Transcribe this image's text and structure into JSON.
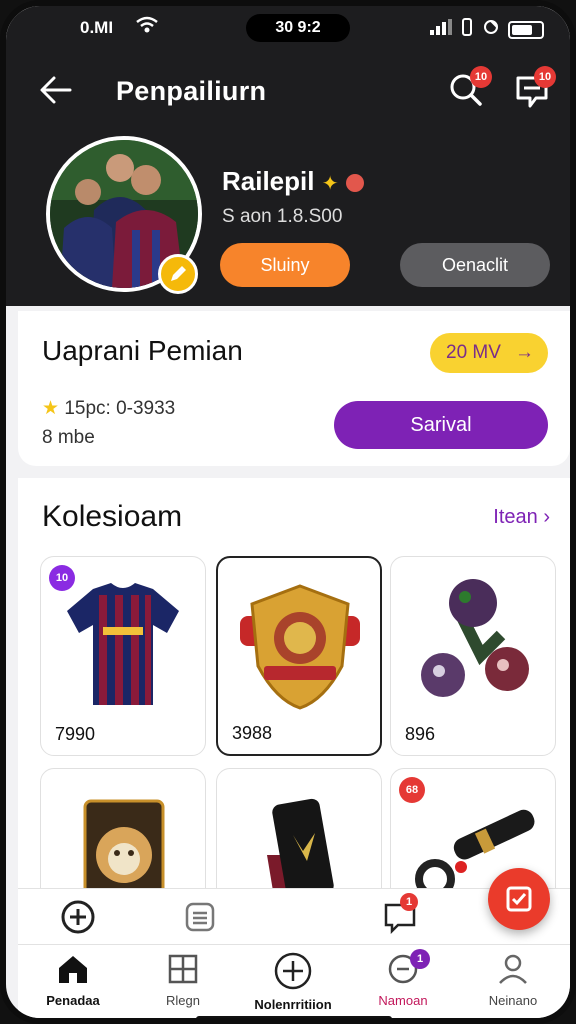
{
  "status": {
    "time": "0.MI",
    "center": "30 9:2",
    "battery_level": 0.7
  },
  "header": {
    "title": "Penpailiurn",
    "search_badge": "10",
    "inbox_badge": "10"
  },
  "profile": {
    "name": "Railepil",
    "subtitle": "S aon 1.8.S00",
    "primary_button": "Sluiny",
    "secondary_button": "Oenaclit"
  },
  "summary": {
    "title": "Uaprani Pemian",
    "pill_label": "20 MV",
    "stat_line": "15pc: 0-3933",
    "stat_line2": "8 mbe",
    "action_button": "Sarival"
  },
  "collection": {
    "title": "Kolesioam",
    "link_label": "Itean",
    "items": [
      {
        "price": "7990",
        "badge": "10",
        "icon": "jersey-icon"
      },
      {
        "price": "3988",
        "badge": "",
        "icon": "shield-crest-icon"
      },
      {
        "price": "896",
        "badge": "",
        "icon": "balls-stand-icon"
      },
      {
        "price": "",
        "badge": "",
        "icon": "lion-card-icon"
      },
      {
        "price": "",
        "badge": "",
        "icon": "phone-stand-icon"
      },
      {
        "price": "",
        "badge": "68",
        "icon": "keychain-icon"
      }
    ]
  },
  "subbar": {
    "badge": "1"
  },
  "nav": {
    "items": [
      {
        "label": "Penadaa",
        "icon": "home-icon"
      },
      {
        "label": "Rlegn",
        "icon": "grid-icon"
      },
      {
        "label": "Nolenrritiion",
        "icon": "plus-circle-icon"
      },
      {
        "label": "Namoan",
        "icon": "chat-icon",
        "badge": "1"
      },
      {
        "label": "Neinano",
        "icon": "user-icon"
      }
    ]
  },
  "colors": {
    "accent": "#7e22b5",
    "orange": "#f7842b",
    "yellow": "#f9d230",
    "red": "#ea3b2b",
    "dark": "#1d1d1f"
  }
}
